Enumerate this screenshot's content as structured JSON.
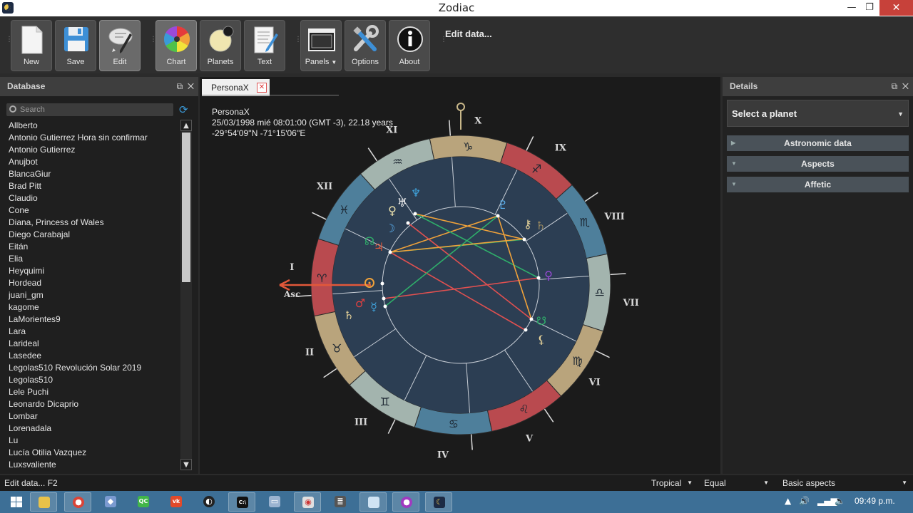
{
  "window": {
    "title": "Zodiac",
    "min": "—",
    "max": "❐",
    "close": "✕"
  },
  "toolbar": {
    "buttons": [
      {
        "label": "New",
        "icon": "new-file-icon"
      },
      {
        "label": "Save",
        "icon": "floppy-disk-icon"
      },
      {
        "label": "Edit",
        "icon": "edit-pencil-icon"
      },
      {
        "label": "Chart",
        "icon": "color-wheel-icon"
      },
      {
        "label": "Planets",
        "icon": "planet-icon"
      },
      {
        "label": "Text",
        "icon": "text-document-icon"
      },
      {
        "label": "Panels",
        "icon": "panels-window-icon"
      },
      {
        "label": "Options",
        "icon": "tools-icon"
      },
      {
        "label": "About",
        "icon": "info-icon"
      }
    ],
    "hint": "Edit data..."
  },
  "left_panel": {
    "title": "Database",
    "search_placeholder": "Search",
    "items": [
      "Allberto",
      "Antonio Gutierrez Hora sin confirmar",
      "Antonio Gutierrez",
      "Anujbot",
      "BlancaGiur",
      "Brad Pitt",
      "Claudio",
      "Cone",
      "Diana, Princess of Wales",
      "Diego Carabajal",
      "Eitán",
      "Elia",
      "Heyquimi",
      "Hordead",
      "juani_gm",
      "kagome",
      "LaMorientes9",
      "Lara",
      "Larideal",
      "Lasedee",
      "Legolas510 Revolución Solar 2019",
      "Legolas510",
      "Lele Puchi",
      "Leonardo Dicaprio",
      "Lombar",
      "Lorenadala",
      "Lu",
      "Lucía Otilia Vazquez",
      "Luxsvaliente"
    ]
  },
  "center": {
    "tab_label": "PersonaX",
    "info": {
      "name": "PersonaX",
      "datetime": "25/03/1998 mié 08:01:00 (GMT -3), 22.18 years",
      "coords": "-29°54'09''N  -71°15'06''E"
    },
    "asc_label": "Asc",
    "houses": [
      "I",
      "II",
      "III",
      "IV",
      "V",
      "VI",
      "VII",
      "VIII",
      "IX",
      "X",
      "XI",
      "XII"
    ],
    "signs": [
      "♑",
      "♐",
      "♏",
      "♎",
      "♍",
      "♌",
      "♋",
      "♊",
      "♉",
      "♈",
      "♓",
      "♒"
    ],
    "colors": {
      "fire": "#b94a4f",
      "earth": "#b9a47c",
      "air": "#a3b4ae",
      "water": "#4e7f9b",
      "inner": "#2c3e53"
    }
  },
  "right_panel": {
    "title": "Details",
    "select_label": "Select a planet",
    "sections": [
      "Astronomic data",
      "Aspects",
      "Affetic"
    ]
  },
  "status": {
    "left": "Edit data...  F2",
    "zodiac": "Tropical",
    "houses": "Equal",
    "aspects": "Basic aspects"
  },
  "taskbar": {
    "time": "09:49 p.m."
  }
}
